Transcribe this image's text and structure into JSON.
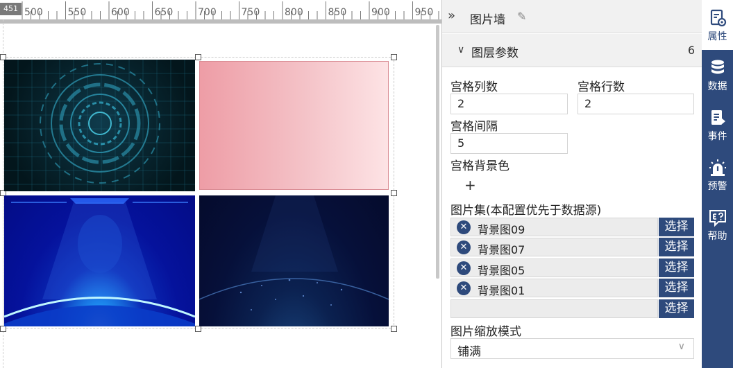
{
  "canvas": {
    "ruler_corner": "451",
    "ruler_ticks": [
      "500",
      "550",
      "600",
      "650",
      "700",
      "750",
      "800",
      "850",
      "900",
      "950"
    ],
    "images": [
      {
        "name": "背景图09"
      },
      {
        "name": "pink-gradient"
      },
      {
        "name": "背景图05"
      },
      {
        "name": "背景图01"
      }
    ]
  },
  "panel": {
    "title": "图片墙",
    "section": {
      "title": "图层参数",
      "count": "6"
    },
    "grid_columns": {
      "label": "宫格列数",
      "value": "2"
    },
    "grid_rows": {
      "label": "宫格行数",
      "value": "2"
    },
    "grid_gap": {
      "label": "宫格间隔",
      "value": "5"
    },
    "grid_bg_color": {
      "label": "宫格背景色",
      "add": "+"
    },
    "image_set": {
      "label": "图片集(本配置优先于数据源)",
      "items": [
        {
          "name": "背景图09",
          "select": "选择",
          "remove": "✕"
        },
        {
          "name": "背景图07",
          "select": "选择",
          "remove": "✕"
        },
        {
          "name": "背景图05",
          "select": "选择",
          "remove": "✕"
        },
        {
          "name": "背景图01",
          "select": "选择",
          "remove": "✕"
        },
        {
          "name": "",
          "select": "选择"
        }
      ]
    },
    "scale_mode": {
      "label": "图片缩放模式",
      "value": "铺满"
    }
  },
  "sidebar": {
    "items": [
      {
        "label": "属性",
        "icon": "properties-icon",
        "active": true
      },
      {
        "label": "数据",
        "icon": "database-icon"
      },
      {
        "label": "事件",
        "icon": "event-icon"
      },
      {
        "label": "预警",
        "icon": "alarm-icon"
      },
      {
        "label": "帮助",
        "icon": "help-icon"
      }
    ]
  },
  "colors": {
    "accent": "#2e4a7c",
    "panel_bg": "#f1f1f1"
  }
}
